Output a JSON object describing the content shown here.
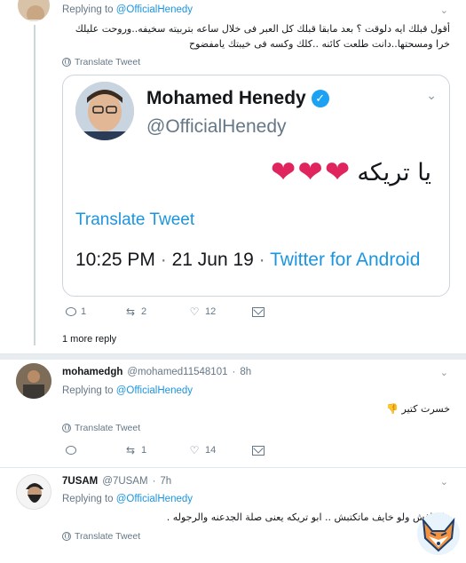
{
  "tweet1": {
    "replying_prefix": "Replying to",
    "replying_handle": "@OfficialHenedy",
    "text": "أقول قبلك ايه دلوقت ؟ بعد مابقا قبلك كل العبر فى خلال ساعه بتربيته سخيفه..وروحت عليلك خرا ومسحتها..دانت طلعت كائنه ..كلك وكسه فى خيبتك يامفضوح",
    "translate_label": "Translate Tweet",
    "quoted": {
      "name": "Mohamed Henedy",
      "handle": "@OfficialHenedy",
      "text": "يا تريكه",
      "hearts": [
        "❤",
        "❤",
        "❤"
      ],
      "translate_label": "Translate Tweet",
      "time": "10:25 PM",
      "date": "21 Jun 19",
      "source": "Twitter for Android"
    },
    "actions": {
      "replies": "1",
      "retweets": "2",
      "likes": "12"
    },
    "more_replies": "1 more reply"
  },
  "tweet2": {
    "name": "mohamedgh",
    "handle": "@mohamed11548101",
    "time": "8h",
    "replying_prefix": "Replying to",
    "replying_handle": "@OfficialHenedy",
    "text": "خسرت كتير 👎",
    "translate_label": "Translate Tweet",
    "actions": {
      "replies": "",
      "retweets": "1",
      "likes": "14"
    }
  },
  "tweet3": {
    "name": "7USAM",
    "handle": "@7USAM",
    "time": "7h",
    "replying_prefix": "Replying to",
    "replying_handle": "@OfficialHenedy",
    "text": "ماتخافش ولو خايف ماتكتبش .. ابو تريكه يعنى صلة الجدعنه والرجوله .",
    "translate_label": "Translate Tweet"
  },
  "colors": {
    "link": "#1b95e0",
    "verified": "#1da1f2",
    "heart": "#e0245e",
    "muted": "#657786"
  }
}
